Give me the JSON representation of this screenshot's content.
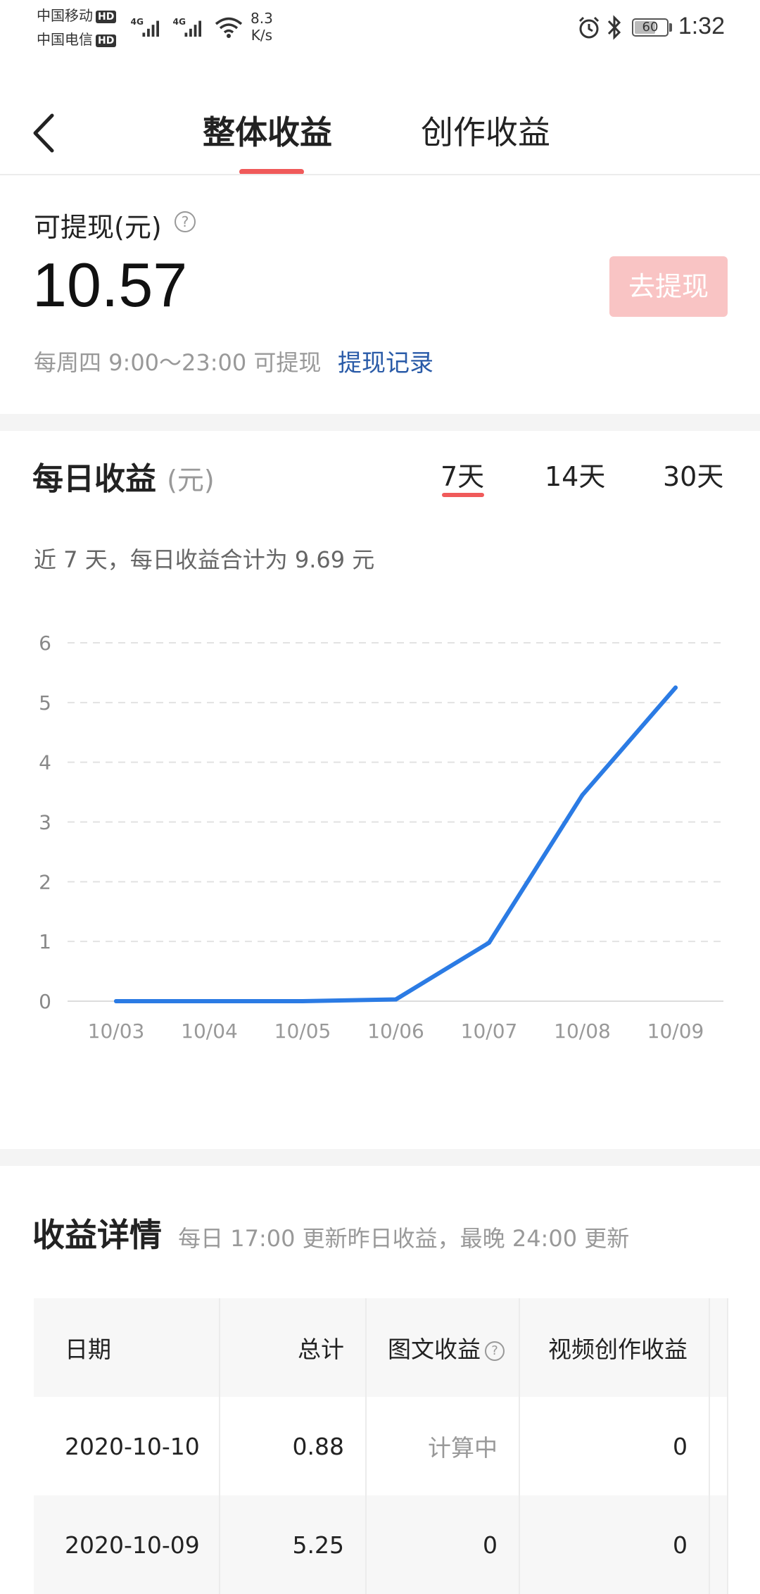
{
  "status_bar": {
    "carrier1": "中国移动",
    "carrier2": "中国电信",
    "hd_label": "HD",
    "net1": "4G",
    "net2": "4G",
    "speed_value": "8.3",
    "speed_unit": "K/s",
    "battery": "60",
    "time": "1:32"
  },
  "header": {
    "tabs": [
      "整体收益",
      "创作收益"
    ]
  },
  "balance": {
    "label": "可提现(元)",
    "amount": "10.57",
    "withdraw_button": "去提现",
    "schedule": "每周四 9:00～23:00 可提现",
    "history_link": "提现记录"
  },
  "daily": {
    "title": "每日收益",
    "unit": "(元)",
    "ranges": [
      "7天",
      "14天",
      "30天"
    ],
    "summary": "近 7 天，每日收益合计为 9.69 元"
  },
  "chart_data": {
    "type": "line",
    "categories": [
      "10/03",
      "10/04",
      "10/05",
      "10/06",
      "10/07",
      "10/08",
      "10/09"
    ],
    "values": [
      0,
      0,
      0,
      0.03,
      0.98,
      3.45,
      5.25
    ],
    "y_ticks": [
      "0",
      "1",
      "2",
      "3",
      "4",
      "5",
      "6"
    ],
    "ylim": [
      0,
      6
    ],
    "grid": true,
    "line_color": "#2b7be4"
  },
  "details": {
    "title": "收益详情",
    "note": "每日 17:00 更新昨日收益，最晚 24:00 更新",
    "columns": [
      "日期",
      "总计",
      "图文收益",
      "视频创作收益"
    ],
    "rows": [
      [
        "2020-10-10",
        "0.88",
        "计算中",
        "0"
      ],
      [
        "2020-10-09",
        "5.25",
        "0",
        "0"
      ]
    ]
  },
  "colors": {
    "accent": "#f05a5a",
    "link": "#2a5ba8",
    "button_disabled": "#f9c4c4"
  }
}
